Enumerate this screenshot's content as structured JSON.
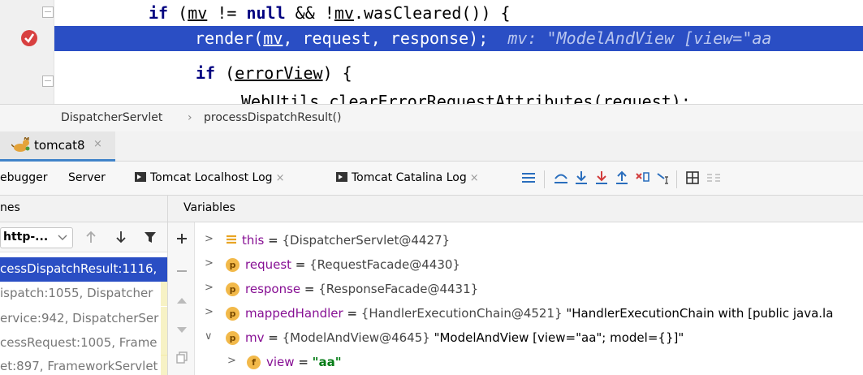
{
  "editor": {
    "line1": {
      "kw_if": "if",
      "open": "(",
      "mv1": "mv",
      "op1": " != ",
      "kw_null": "null",
      "op2": " && !",
      "mv2": "mv",
      "rest": ".wasCleared()) {"
    },
    "line2": {
      "call": "render(",
      "mv": "mv",
      "args": ", request, response);",
      "hint": "mv: \"ModelAndView [view=\"aa"
    },
    "line3": {
      "kw_if": "if",
      "open": "(",
      "var": "errorView",
      "close": ") {"
    },
    "line4": {
      "text": "WebUtils.clearErrorRequestAttributes(request);"
    }
  },
  "breadcrumb": {
    "cls": "DispatcherServlet",
    "sep": "›",
    "method": "processDispatchResult()"
  },
  "run_tab": {
    "label": "tomcat8",
    "close": "×"
  },
  "debug_tabs": {
    "debugger": "ebugger",
    "server": "Server",
    "localhost_log": "Tomcat Localhost Log",
    "catalina_log": "Tomcat Catalina Log",
    "close": "×"
  },
  "toolbar_icons": [
    "show-execution-point-icon",
    "step-over-icon",
    "step-into-icon",
    "force-step-into-icon",
    "step-out-icon",
    "drop-frame-icon",
    "run-to-cursor-icon",
    "evaluate-expression-icon",
    "trace-icon"
  ],
  "frames": {
    "header": "nes",
    "thread": "http-...",
    "items": [
      {
        "text": "cessDispatchResult:1116,",
        "selected": true
      },
      {
        "text": "ispatch:1055, Dispatcher",
        "selected": false
      },
      {
        "text": "ervice:942, DispatcherSer",
        "selected": false
      },
      {
        "text": "cessRequest:1005, Frame",
        "selected": false
      },
      {
        "text": "et:897, FrameworkServlet",
        "selected": false
      }
    ]
  },
  "variables": {
    "header": "Variables",
    "items": [
      {
        "name": "this",
        "eq": " = ",
        "ref": "{DispatcherServlet@4427}",
        "str": "",
        "kind": "lines"
      },
      {
        "name": "request",
        "eq": " = ",
        "ref": "{RequestFacade@4430}",
        "str": "",
        "kind": "p"
      },
      {
        "name": "response",
        "eq": " = ",
        "ref": "{ResponseFacade@4431}",
        "str": "",
        "kind": "p"
      },
      {
        "name": "mappedHandler",
        "eq": " = ",
        "ref": "{HandlerExecutionChain@4521}",
        "str": " \"HandlerExecutionChain with [public java.la",
        "kind": "p"
      },
      {
        "name": "mv",
        "eq": " = ",
        "ref": "{ModelAndView@4645}",
        "str": " \"ModelAndView [view=\"aa\"; model={}]\"",
        "kind": "p"
      },
      {
        "name": "view",
        "eq": " = ",
        "ref": "",
        "str": "\"aa\"",
        "kind": "f"
      }
    ]
  },
  "colors": {
    "selection": "#2a4ec4",
    "keyword": "#000080",
    "var_name": "#871094",
    "string": "#067d17",
    "badge": "#f2b94a"
  }
}
